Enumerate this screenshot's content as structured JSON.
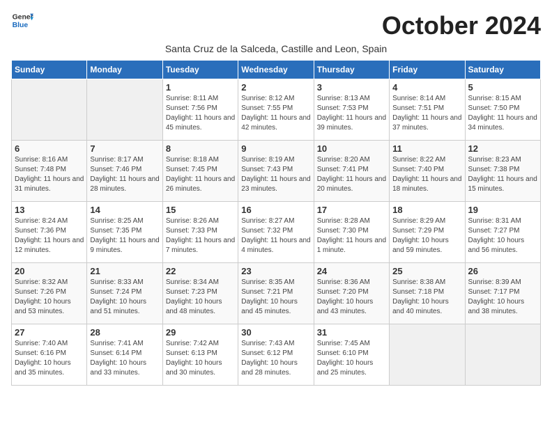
{
  "header": {
    "logo_general": "General",
    "logo_blue": "Blue",
    "month_title": "October 2024",
    "subtitle": "Santa Cruz de la Salceda, Castille and Leon, Spain"
  },
  "weekdays": [
    "Sunday",
    "Monday",
    "Tuesday",
    "Wednesday",
    "Thursday",
    "Friday",
    "Saturday"
  ],
  "weeks": [
    [
      {
        "day": "",
        "detail": ""
      },
      {
        "day": "",
        "detail": ""
      },
      {
        "day": "1",
        "detail": "Sunrise: 8:11 AM\nSunset: 7:56 PM\nDaylight: 11 hours and 45 minutes."
      },
      {
        "day": "2",
        "detail": "Sunrise: 8:12 AM\nSunset: 7:55 PM\nDaylight: 11 hours and 42 minutes."
      },
      {
        "day": "3",
        "detail": "Sunrise: 8:13 AM\nSunset: 7:53 PM\nDaylight: 11 hours and 39 minutes."
      },
      {
        "day": "4",
        "detail": "Sunrise: 8:14 AM\nSunset: 7:51 PM\nDaylight: 11 hours and 37 minutes."
      },
      {
        "day": "5",
        "detail": "Sunrise: 8:15 AM\nSunset: 7:50 PM\nDaylight: 11 hours and 34 minutes."
      }
    ],
    [
      {
        "day": "6",
        "detail": "Sunrise: 8:16 AM\nSunset: 7:48 PM\nDaylight: 11 hours and 31 minutes."
      },
      {
        "day": "7",
        "detail": "Sunrise: 8:17 AM\nSunset: 7:46 PM\nDaylight: 11 hours and 28 minutes."
      },
      {
        "day": "8",
        "detail": "Sunrise: 8:18 AM\nSunset: 7:45 PM\nDaylight: 11 hours and 26 minutes."
      },
      {
        "day": "9",
        "detail": "Sunrise: 8:19 AM\nSunset: 7:43 PM\nDaylight: 11 hours and 23 minutes."
      },
      {
        "day": "10",
        "detail": "Sunrise: 8:20 AM\nSunset: 7:41 PM\nDaylight: 11 hours and 20 minutes."
      },
      {
        "day": "11",
        "detail": "Sunrise: 8:22 AM\nSunset: 7:40 PM\nDaylight: 11 hours and 18 minutes."
      },
      {
        "day": "12",
        "detail": "Sunrise: 8:23 AM\nSunset: 7:38 PM\nDaylight: 11 hours and 15 minutes."
      }
    ],
    [
      {
        "day": "13",
        "detail": "Sunrise: 8:24 AM\nSunset: 7:36 PM\nDaylight: 11 hours and 12 minutes."
      },
      {
        "day": "14",
        "detail": "Sunrise: 8:25 AM\nSunset: 7:35 PM\nDaylight: 11 hours and 9 minutes."
      },
      {
        "day": "15",
        "detail": "Sunrise: 8:26 AM\nSunset: 7:33 PM\nDaylight: 11 hours and 7 minutes."
      },
      {
        "day": "16",
        "detail": "Sunrise: 8:27 AM\nSunset: 7:32 PM\nDaylight: 11 hours and 4 minutes."
      },
      {
        "day": "17",
        "detail": "Sunrise: 8:28 AM\nSunset: 7:30 PM\nDaylight: 11 hours and 1 minute."
      },
      {
        "day": "18",
        "detail": "Sunrise: 8:29 AM\nSunset: 7:29 PM\nDaylight: 10 hours and 59 minutes."
      },
      {
        "day": "19",
        "detail": "Sunrise: 8:31 AM\nSunset: 7:27 PM\nDaylight: 10 hours and 56 minutes."
      }
    ],
    [
      {
        "day": "20",
        "detail": "Sunrise: 8:32 AM\nSunset: 7:26 PM\nDaylight: 10 hours and 53 minutes."
      },
      {
        "day": "21",
        "detail": "Sunrise: 8:33 AM\nSunset: 7:24 PM\nDaylight: 10 hours and 51 minutes."
      },
      {
        "day": "22",
        "detail": "Sunrise: 8:34 AM\nSunset: 7:23 PM\nDaylight: 10 hours and 48 minutes."
      },
      {
        "day": "23",
        "detail": "Sunrise: 8:35 AM\nSunset: 7:21 PM\nDaylight: 10 hours and 45 minutes."
      },
      {
        "day": "24",
        "detail": "Sunrise: 8:36 AM\nSunset: 7:20 PM\nDaylight: 10 hours and 43 minutes."
      },
      {
        "day": "25",
        "detail": "Sunrise: 8:38 AM\nSunset: 7:18 PM\nDaylight: 10 hours and 40 minutes."
      },
      {
        "day": "26",
        "detail": "Sunrise: 8:39 AM\nSunset: 7:17 PM\nDaylight: 10 hours and 38 minutes."
      }
    ],
    [
      {
        "day": "27",
        "detail": "Sunrise: 7:40 AM\nSunset: 6:16 PM\nDaylight: 10 hours and 35 minutes."
      },
      {
        "day": "28",
        "detail": "Sunrise: 7:41 AM\nSunset: 6:14 PM\nDaylight: 10 hours and 33 minutes."
      },
      {
        "day": "29",
        "detail": "Sunrise: 7:42 AM\nSunset: 6:13 PM\nDaylight: 10 hours and 30 minutes."
      },
      {
        "day": "30",
        "detail": "Sunrise: 7:43 AM\nSunset: 6:12 PM\nDaylight: 10 hours and 28 minutes."
      },
      {
        "day": "31",
        "detail": "Sunrise: 7:45 AM\nSunset: 6:10 PM\nDaylight: 10 hours and 25 minutes."
      },
      {
        "day": "",
        "detail": ""
      },
      {
        "day": "",
        "detail": ""
      }
    ]
  ]
}
